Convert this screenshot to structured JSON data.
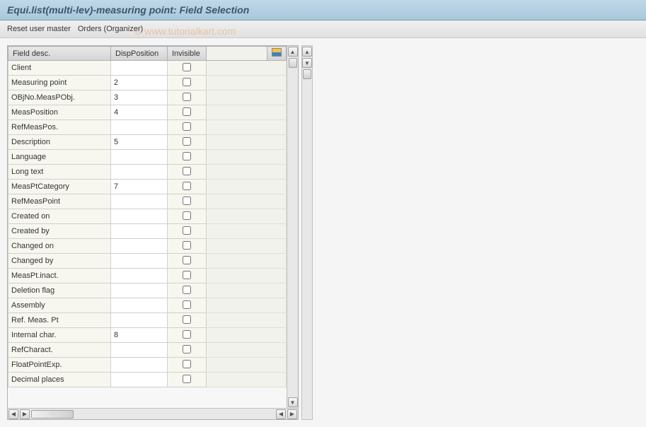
{
  "title": "Equi.list(multi-lev)-measuring point: Field Selection",
  "toolbar": {
    "reset_user_master": "Reset user master",
    "orders_organizer": "Orders (Organizer)"
  },
  "watermark": "© www.tutorialkart.com",
  "table": {
    "headers": {
      "field_desc": "Field desc.",
      "disp_position": "DispPosition",
      "invisible": "Invisible"
    },
    "rows": [
      {
        "desc": "Client",
        "pos": "",
        "inv": false
      },
      {
        "desc": "Measuring point",
        "pos": "2",
        "inv": false
      },
      {
        "desc": "OBjNo.MeasPObj.",
        "pos": "3",
        "inv": false
      },
      {
        "desc": "MeasPosition",
        "pos": "4",
        "inv": false
      },
      {
        "desc": "RefMeasPos.",
        "pos": "",
        "inv": false
      },
      {
        "desc": "Description",
        "pos": "5",
        "inv": false
      },
      {
        "desc": "Language",
        "pos": "",
        "inv": false
      },
      {
        "desc": "Long text",
        "pos": "",
        "inv": false
      },
      {
        "desc": "MeasPtCategory",
        "pos": "7",
        "inv": false
      },
      {
        "desc": "RefMeasPoint",
        "pos": "",
        "inv": false
      },
      {
        "desc": "Created on",
        "pos": "",
        "inv": false
      },
      {
        "desc": "Created by",
        "pos": "",
        "inv": false
      },
      {
        "desc": "Changed on",
        "pos": "",
        "inv": false
      },
      {
        "desc": "Changed by",
        "pos": "",
        "inv": false
      },
      {
        "desc": "MeasPt.inact.",
        "pos": "",
        "inv": false
      },
      {
        "desc": "Deletion flag",
        "pos": "",
        "inv": false
      },
      {
        "desc": "Assembly",
        "pos": "",
        "inv": false
      },
      {
        "desc": "Ref. Meas. Pt",
        "pos": "",
        "inv": false
      },
      {
        "desc": "Internal char.",
        "pos": "8",
        "inv": false
      },
      {
        "desc": "RefCharact.",
        "pos": "",
        "inv": false
      },
      {
        "desc": "FloatPointExp.",
        "pos": "",
        "inv": false
      },
      {
        "desc": "Decimal places",
        "pos": "",
        "inv": false
      }
    ]
  }
}
